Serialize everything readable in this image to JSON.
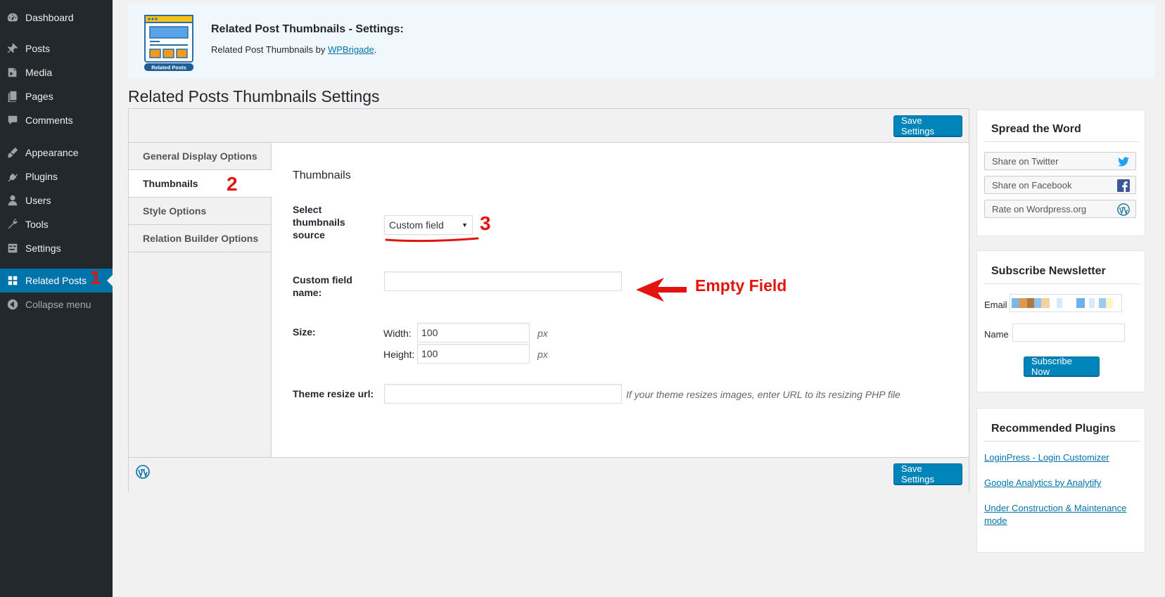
{
  "sidebar": {
    "items": [
      {
        "label": "Dashboard",
        "icon": "dashboard-icon"
      },
      {
        "label": "Posts",
        "icon": "pin-icon"
      },
      {
        "label": "Media",
        "icon": "media-icon"
      },
      {
        "label": "Pages",
        "icon": "pages-icon"
      },
      {
        "label": "Comments",
        "icon": "comments-icon"
      },
      {
        "label": "Appearance",
        "icon": "brush-icon"
      },
      {
        "label": "Plugins",
        "icon": "plugin-icon"
      },
      {
        "label": "Users",
        "icon": "user-icon"
      },
      {
        "label": "Tools",
        "icon": "wrench-icon"
      },
      {
        "label": "Settings",
        "icon": "settings-icon"
      },
      {
        "label": "Related Posts",
        "icon": "grid-icon",
        "current": true
      },
      {
        "label": "Collapse menu",
        "icon": "collapse-icon"
      }
    ]
  },
  "banner": {
    "title": "Related Post Thumbnails - Settings:",
    "sub_prefix": "Related Post Thumbnails",
    "sub_by": " by ",
    "sub_link": "WPBrigade",
    "sub_suffix": ".",
    "logo_caption": "Related Posts"
  },
  "page_title": "Related Posts Thumbnails Settings",
  "buttons": {
    "save_top": "Save Settings",
    "save_bottom": "Save Settings"
  },
  "tabs": [
    {
      "label": "General Display Options"
    },
    {
      "label": "Thumbnails",
      "active": true
    },
    {
      "label": "Style Options"
    },
    {
      "label": "Relation Builder Options"
    }
  ],
  "panel": {
    "section_title": "Thumbnails",
    "source_label": "Select thumbnails source",
    "source_value": "Custom field",
    "custom_field_label": "Custom field name:",
    "custom_field_value": "",
    "size_label": "Size:",
    "width_label": "Width:",
    "width_value": "100",
    "height_label": "Height:",
    "height_value": "100",
    "unit": "px",
    "resize_label": "Theme resize url:",
    "resize_value": "",
    "resize_desc": "If your theme resizes images, enter URL to its resizing PHP file"
  },
  "widgets": {
    "spread": {
      "title": "Spread the Word",
      "buttons": [
        {
          "label": "Share on Twitter",
          "icon": "twitter-icon"
        },
        {
          "label": "Share on Facebook",
          "icon": "facebook-icon"
        },
        {
          "label": "Rate on Wordpress.org",
          "icon": "wordpress-icon"
        }
      ]
    },
    "newsletter": {
      "title": "Subscribe Newsletter",
      "email_label": "Email",
      "name_label": "Name",
      "button": "Subscribe Now"
    },
    "recommended": {
      "title": "Recommended Plugins",
      "links": [
        "LoginPress - Login Customizer",
        "Google Analytics by Analytify",
        "Under Construction & Maintenance mode"
      ]
    }
  },
  "annotations": {
    "one": "1",
    "two": "2",
    "three": "3",
    "empty_field": "Empty Field"
  },
  "colors": {
    "sidebar_bg": "#23282d",
    "accent": "#0073aa",
    "button": "#0085ba",
    "annotation": "#e3140d"
  }
}
